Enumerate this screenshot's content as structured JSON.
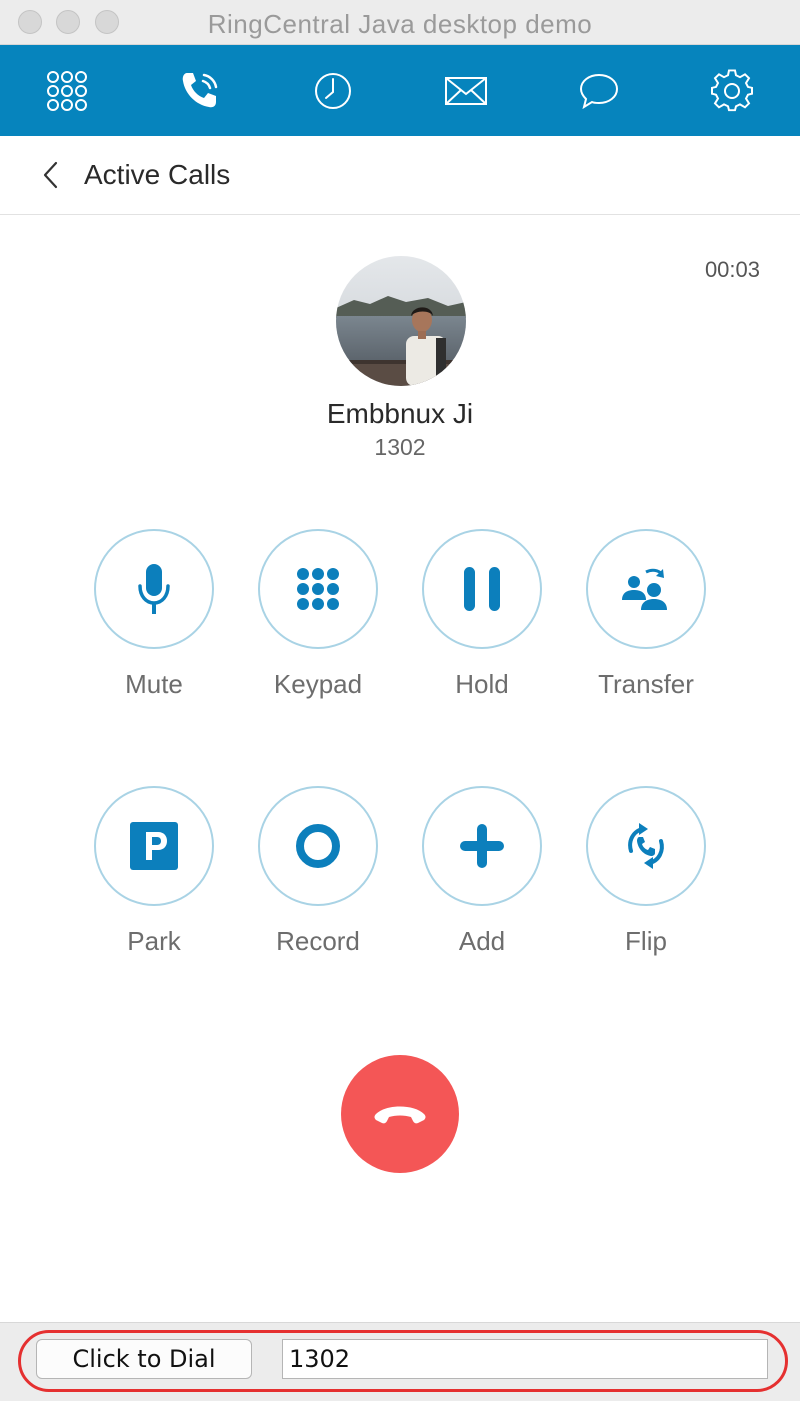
{
  "window": {
    "title": "RingCentral Java desktop demo"
  },
  "nav": {
    "items": [
      {
        "name": "dialpad",
        "icon": "dialpad-grid-icon"
      },
      {
        "name": "active-calls",
        "icon": "phone-call-icon",
        "selected": true
      },
      {
        "name": "history",
        "icon": "clock-icon"
      },
      {
        "name": "messages",
        "icon": "envelope-icon"
      },
      {
        "name": "chat",
        "icon": "chat-bubble-icon"
      },
      {
        "name": "settings",
        "icon": "gear-icon"
      }
    ]
  },
  "header": {
    "back_icon": "chevron-left-icon",
    "title": "Active Calls"
  },
  "call": {
    "timer": "00:03",
    "caller_name": "Embbnux Ji",
    "caller_number": "1302"
  },
  "controls": [
    {
      "label": "Mute",
      "icon": "microphone-icon"
    },
    {
      "label": "Keypad",
      "icon": "keypad-icon"
    },
    {
      "label": "Hold",
      "icon": "pause-icon"
    },
    {
      "label": "Transfer",
      "icon": "transfer-icon"
    },
    {
      "label": "Park",
      "icon": "park-icon"
    },
    {
      "label": "Record",
      "icon": "record-icon"
    },
    {
      "label": "Add",
      "icon": "plus-icon"
    },
    {
      "label": "Flip",
      "icon": "flip-icon"
    }
  ],
  "hangup": {
    "icon": "hang-up-icon"
  },
  "bottom_bar": {
    "dial_button_label": "Click to Dial",
    "dial_input_value": "1302"
  },
  "colors": {
    "brand_blue": "#0684bd",
    "hangup_red": "#f45656",
    "control_border": "#a9d3e5",
    "highlight_red": "#e53030"
  }
}
